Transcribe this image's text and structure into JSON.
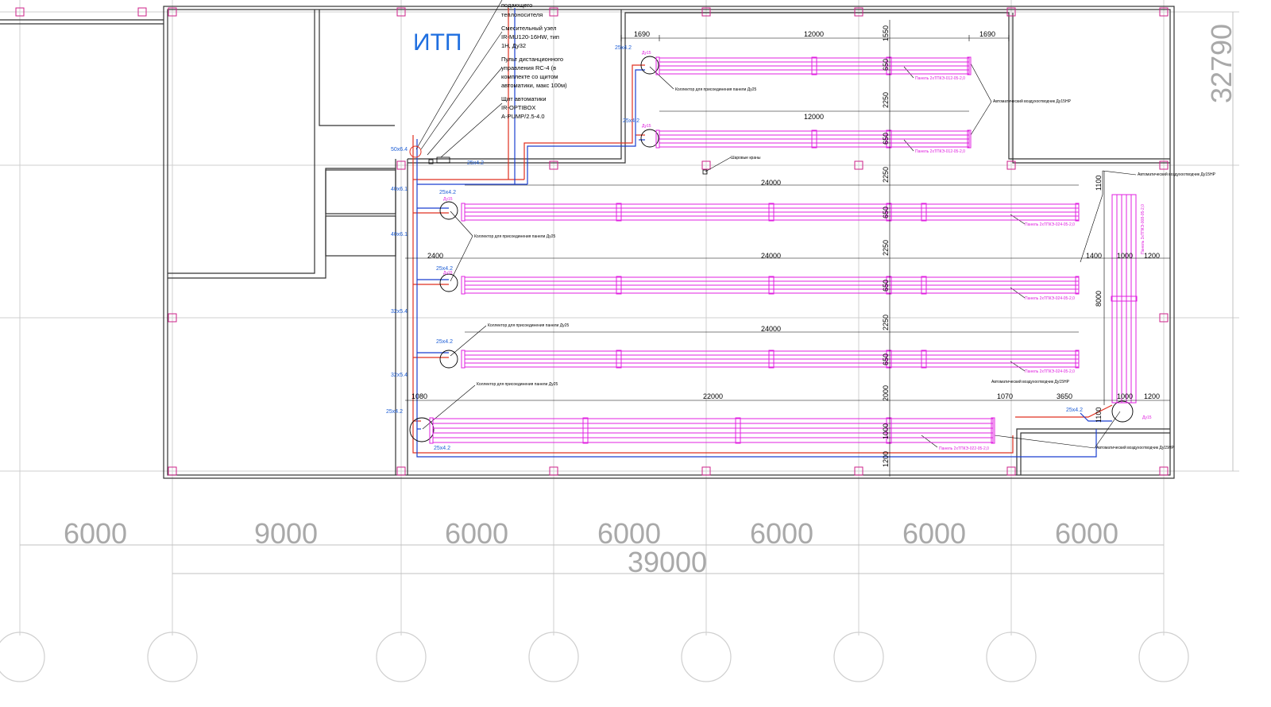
{
  "drawing": {
    "room_label": "ИТП",
    "overall_width": "39000",
    "overall_height": "32790",
    "bay_dimensions": [
      "6000",
      "9000",
      "6000",
      "6000",
      "6000",
      "6000",
      "6000"
    ]
  },
  "notes": {
    "supply_fragment": [
      "подающего",
      "теплоносителя"
    ],
    "mixing_unit": [
      "Смесительный узел",
      "IR-MU120-16HW, тип",
      "1Н, Ду32"
    ],
    "remote_panel": [
      "Пульт дистанционного",
      "управления RC-4 (в",
      "комплекте со щитом",
      "автоматики, макс 100м)"
    ],
    "control_cabinet": [
      "Щит автоматики",
      "IR-OPTIBOX",
      "A-PUMP/2.5-4.0"
    ]
  },
  "dimensions": {
    "row1_left": "1690",
    "row1_center": "12000",
    "row1_right": "1690",
    "row2_center": "12000",
    "row3_center": "24000",
    "row4_left": "2400",
    "row4_center": "24000",
    "row5_center": "24000",
    "row6_left": "1080",
    "row6_center": "22000",
    "row6_r1": "1070",
    "row6_r2": "3650",
    "right_a": "1400",
    "right_b": "1000",
    "right_c": "1200",
    "right_d": "1000",
    "right_e": "1200",
    "right_height": "8000",
    "right_top": "1100",
    "right_bottom": "1100",
    "vertical_chain": [
      "1550",
      "650",
      "2250",
      "650",
      "2250",
      "650",
      "2250",
      "650",
      "2250",
      "650",
      "2000",
      "1000",
      "1200"
    ]
  },
  "pipe_sizes": {
    "p1": "25x4.2",
    "p2": "25x4.2",
    "p3": "25x4.2",
    "p4": "25x4.2",
    "p5": "25x4.2",
    "p6": "25x4.2",
    "p7": "25x4.2",
    "p8": "25x4.2",
    "p9": "25x4.2",
    "p10": "50x6.4",
    "p11": "40x6.1",
    "p12": "40x6.1",
    "p13": "32x5.4",
    "p14": "32x5.4"
  },
  "small_notes": {
    "collector": "Коллектор для присоединения панели Ду25",
    "auto_vent": "Автоматический воздухоотводчик Ду15НР",
    "ball_valves": "Шаровые краны",
    "panel_a": "Панель 2хТПКЭ-012-05-2,0",
    "panel_b": "Панель 2хТПКЭ-024-05-2,0",
    "panel_c": "Панель 2хТПКЭ-022-05-2,0",
    "panel_d": "Панель 3хТПКЭ-008-05-2,0",
    "du": "Ду15"
  },
  "colors": {
    "panel": "#e020e0",
    "supply": "#e03020",
    "return": "#1a3fd0",
    "grid": "#c8c8c8",
    "wall": "#333333",
    "column": "#cc2288",
    "label_blue": "#1f6fe0"
  }
}
